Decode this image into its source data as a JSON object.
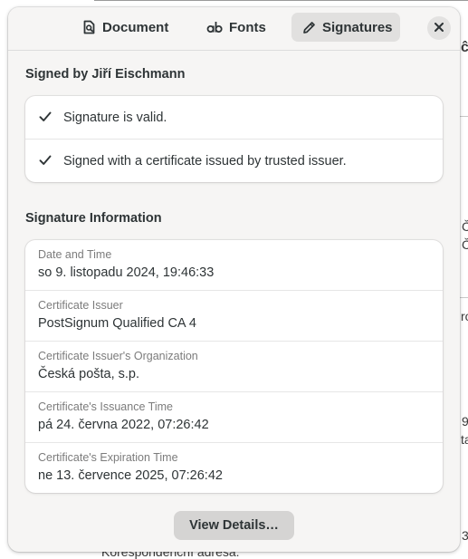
{
  "background_document": {
    "fragments": [
      "ĉ",
      "Č",
      "Č",
      "ro",
      "9",
      "ta",
      "3",
      "Korespondenční adresa:"
    ]
  },
  "header": {
    "tabs": [
      {
        "label": "Document",
        "icon": "document-search-icon",
        "active": false
      },
      {
        "label": "Fonts",
        "icon": "font-ab-icon",
        "active": false
      },
      {
        "label": "Signatures",
        "icon": "pen-icon",
        "active": true
      }
    ],
    "close_icon": "close-icon"
  },
  "signed_section": {
    "title": "Signed by Jiří Eischmann",
    "checks": [
      {
        "icon": "checkmark-icon",
        "text": "Signature is valid."
      },
      {
        "icon": "checkmark-icon",
        "text": "Signed with a certificate issued by trusted issuer."
      }
    ]
  },
  "info_section": {
    "title": "Signature Information",
    "rows": [
      {
        "label": "Date and Time",
        "value": "so 9. listopadu 2024, 19:46:33"
      },
      {
        "label": "Certificate Issuer",
        "value": "PostSignum Qualified CA 4"
      },
      {
        "label": "Certificate Issuer's Organization",
        "value": "Česká pošta, s.p."
      },
      {
        "label": "Certificate's Issuance Time",
        "value": "pá 24. června 2022, 07:26:42"
      },
      {
        "label": "Certificate's Expiration Time",
        "value": "ne 13. července 2025, 07:26:42"
      }
    ]
  },
  "footer": {
    "details_label": "View Details…"
  },
  "colors": {
    "dialog_bg": "#f6f5f4",
    "card_bg": "#ffffff",
    "active_tab_bg": "#e1e0df",
    "button_bg": "#d5d4d3",
    "label_gray": "#7c7c7c",
    "text": "#2e3436"
  }
}
